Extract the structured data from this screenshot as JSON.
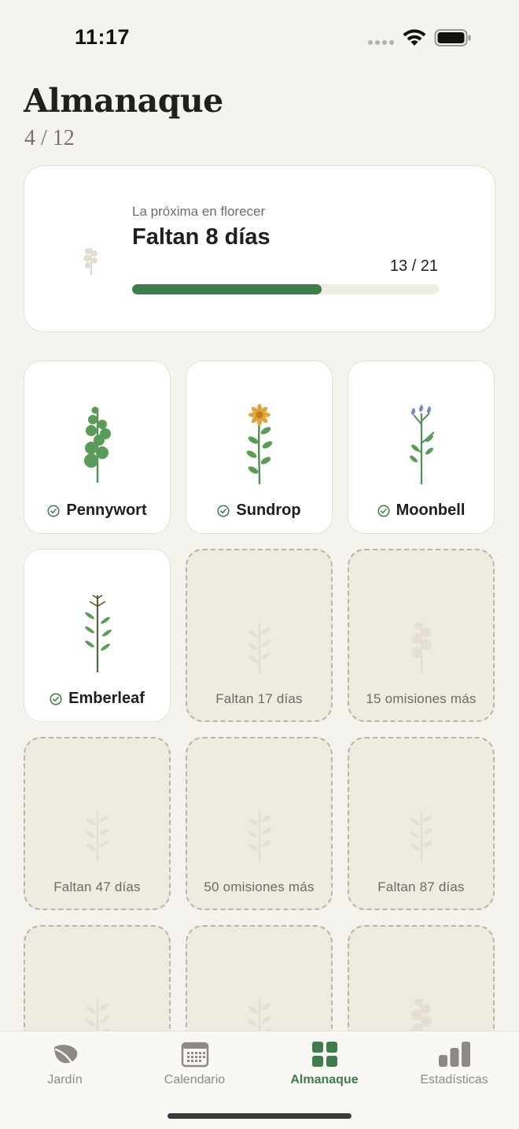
{
  "status_bar": {
    "time": "11:17"
  },
  "header": {
    "title": "Almanaque",
    "count": "4 / 12"
  },
  "next_bloom": {
    "label": "La próxima en florecer",
    "title": "Faltan 8 días",
    "progress_text": "13 / 21",
    "progress_value": 13,
    "progress_total": 21
  },
  "grid": {
    "tiles": [
      {
        "status": "found",
        "text": "Pennywort",
        "icon": "pennywort-plant-icon"
      },
      {
        "status": "found",
        "text": "Sundrop",
        "icon": "sundrop-flower-icon"
      },
      {
        "status": "found",
        "text": "Moonbell",
        "icon": "moonbell-flower-icon"
      },
      {
        "status": "found",
        "text": "Emberleaf",
        "icon": "emberleaf-plant-icon"
      },
      {
        "status": "locked",
        "text": "Faltan 17 días",
        "icon": "locked-sprig-icon"
      },
      {
        "status": "locked",
        "text": "15 omisiones más",
        "icon": "locked-round-leaf-icon"
      },
      {
        "status": "locked",
        "text": "Faltan 47 días",
        "icon": "locked-sprig-icon"
      },
      {
        "status": "locked",
        "text": "50 omisiones más",
        "icon": "locked-sprig-icon"
      },
      {
        "status": "locked",
        "text": "Faltan 87 días",
        "icon": "locked-sprig-icon"
      },
      {
        "status": "locked",
        "text": "",
        "icon": "locked-sprig-icon"
      },
      {
        "status": "locked",
        "text": "",
        "icon": "locked-sprig-icon"
      },
      {
        "status": "locked",
        "text": "",
        "icon": "locked-round-leaf-icon"
      }
    ]
  },
  "tab_bar": {
    "tabs": [
      {
        "label": "Jardín",
        "icon": "leaf-icon",
        "active": false
      },
      {
        "label": "Calendario",
        "icon": "calendar-icon",
        "active": false
      },
      {
        "label": "Almanaque",
        "icon": "grid-icon",
        "active": true
      },
      {
        "label": "Estadísticas",
        "icon": "bar-chart-icon",
        "active": false
      }
    ]
  },
  "colors": {
    "accent": "#3e7c4c",
    "background": "#f5f3ed",
    "locked_tile": "#eeebe0"
  }
}
